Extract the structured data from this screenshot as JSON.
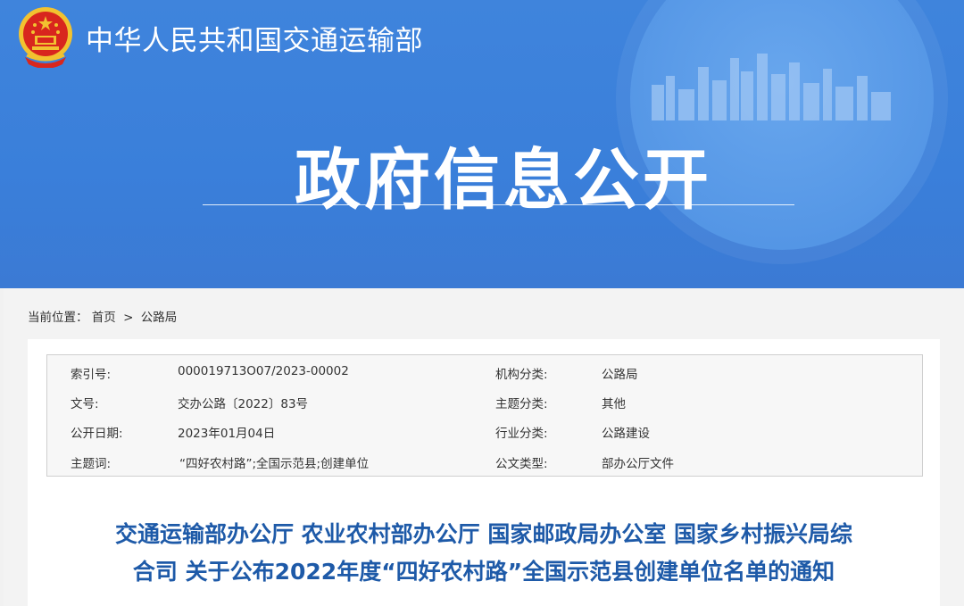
{
  "header": {
    "ministry_name": "中华人民共和国交通运输部",
    "banner_title": "政府信息公开"
  },
  "breadcrumb": {
    "prefix": "当前位置：",
    "items": [
      "首页",
      "公路局"
    ],
    "separator": ">"
  },
  "meta": {
    "left": [
      {
        "label": "索引号:",
        "value": "000019713O07/2023-00002"
      },
      {
        "label": "文号:",
        "value": "交办公路〔2022〕83号"
      },
      {
        "label": "公开日期:",
        "value": "2023年01月04日"
      },
      {
        "label": "主题词:",
        "value": "“四好农村路”;全国示范县;创建单位"
      }
    ],
    "right": [
      {
        "label": "机构分类:",
        "value": "公路局"
      },
      {
        "label": "主题分类:",
        "value": "其他"
      },
      {
        "label": "行业分类:",
        "value": "公路建设"
      },
      {
        "label": "公文类型:",
        "value": "部办公厅文件"
      }
    ]
  },
  "document": {
    "title_line1": "交通运输部办公厅 农业农村部办公厅 国家邮政局办公室 国家乡村振兴局综",
    "title_line2": "合司 关于公布2022年度“四好农村路”全国示范县创建单位名单的通知"
  },
  "colors": {
    "banner_blue": "#3f84dc",
    "title_blue": "#1e5aa8"
  },
  "icons": [
    "national-emblem-icon"
  ]
}
